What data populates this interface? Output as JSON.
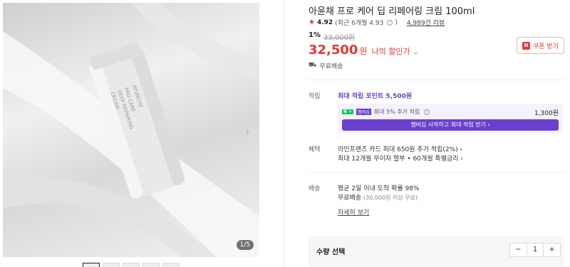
{
  "product": {
    "title": "아윤채 프로 케어 딥 리페어링 크림 100ml",
    "rating": "4.92",
    "rating_recent": "(최근 6개월 4.93",
    "rating_recent_close": ")",
    "review_count": "4,989건 리뷰",
    "discount_percent": "1%",
    "original_price": "33,000원",
    "price": "32,500",
    "price_unit": "원",
    "my_price_label": "나의 할인가",
    "free_shipping": "무료배송",
    "coupon_label": "쿠폰 받기",
    "image_label_line1": "AYUNCHE",
    "image_label_line2": "PRO CARE",
    "image_label_line3": "DEEP REPAIRING",
    "image_label_line4": "CREAM"
  },
  "gallery": {
    "counter": "1/5"
  },
  "points": {
    "label": "적립",
    "max_points": "최대 적립 포인트 5,500원",
    "membership_badge_n": "N +",
    "membership_badge_m": "멤버십",
    "membership_extra": "최대 5% 추가 적립",
    "membership_amount": "1,300원",
    "membership_button": "멤버십 시작하고 최대 적립 받기"
  },
  "benefits": {
    "label": "혜택",
    "card": "라인프렌즈 카드 최대 650원 추가 적립(2%)",
    "installment": "최대 12개월 무이자 할부 • 60개월 특별금리"
  },
  "delivery": {
    "label": "배송",
    "arrival": "평균 2일 이내 도착 확률 98%",
    "free": "무료배송",
    "free_condition": "(30,000원 이상 무료)",
    "detail_link": "자세히 보기"
  },
  "quantity": {
    "label": "수량 선택",
    "minus": "−",
    "value": "1",
    "plus": "+"
  }
}
